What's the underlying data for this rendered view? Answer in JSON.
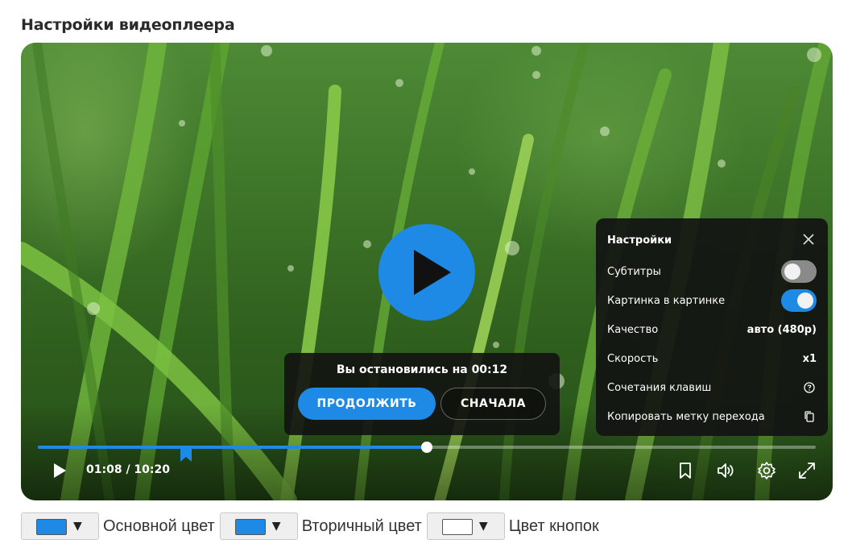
{
  "page": {
    "title": "Настройки видеоплеера"
  },
  "player": {
    "resume": {
      "title": "Вы остановились на 00:12",
      "continue_label": "ПРОДОЛЖИТЬ",
      "restart_label": "СНАЧАЛА"
    },
    "settings": {
      "title": "Настройки",
      "items": [
        {
          "label": "Субтитры",
          "type": "toggle",
          "on": false
        },
        {
          "label": "Картинка в картинке",
          "type": "toggle",
          "on": true
        },
        {
          "label": "Качество",
          "type": "value",
          "value": "авто (480p)"
        },
        {
          "label": "Скорость",
          "type": "value",
          "value": "x1"
        },
        {
          "label": "Сочетания клавиш",
          "type": "icon",
          "icon": "help-circle-icon"
        },
        {
          "label": "Копировать метку перехода",
          "type": "icon",
          "icon": "copy-icon"
        }
      ]
    },
    "time": "01:08 / 10:20",
    "progress_fraction": 0.5,
    "bookmark_fraction": 0.19,
    "icons": [
      "play-icon",
      "bookmark-icon",
      "volume-icon",
      "settings-gear-icon",
      "fullscreen-icon",
      "close-icon"
    ]
  },
  "colors": {
    "accent": "#1e8ae6",
    "primary_swatch": "#1e8ae6",
    "secondary_swatch": "#1e8ae6",
    "buttons_swatch": "#ffffff",
    "panel_bg": "#121212"
  },
  "color_pickers": [
    {
      "label": "Основной цвет",
      "caret": "▼"
    },
    {
      "label": "Вторичный цвет",
      "caret": "▼"
    },
    {
      "label": "Цвет кнопок",
      "caret": "▼"
    }
  ]
}
